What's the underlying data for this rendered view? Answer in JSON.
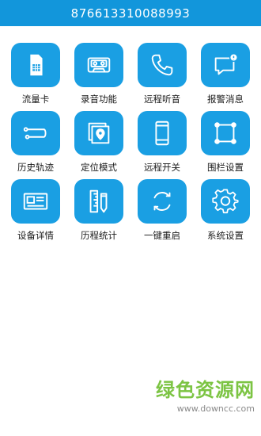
{
  "header": {
    "title": "876613310088993"
  },
  "colors": {
    "header_bg": "#1296db",
    "tile_bg": "#1a9fe3",
    "watermark_green": "#7cc443"
  },
  "menu": [
    {
      "label": "流量卡",
      "icon": "sim-card-icon"
    },
    {
      "label": "录音功能",
      "icon": "cassette-tape-icon"
    },
    {
      "label": "远程听音",
      "icon": "phone-icon"
    },
    {
      "label": "报警消息",
      "icon": "message-alert-icon"
    },
    {
      "label": "历史轨迹",
      "icon": "track-route-icon"
    },
    {
      "label": "定位模式",
      "icon": "location-photos-icon"
    },
    {
      "label": "远程开关",
      "icon": "smartphone-icon"
    },
    {
      "label": "围栏设置",
      "icon": "fence-square-icon"
    },
    {
      "label": "设备详情",
      "icon": "id-card-icon"
    },
    {
      "label": "历程统计",
      "icon": "ruler-pencil-icon"
    },
    {
      "label": "一键重启",
      "icon": "restart-icon"
    },
    {
      "label": "系统设置",
      "icon": "gear-icon"
    }
  ],
  "watermark": {
    "main": "绿色资源网",
    "url": "www.downcc.com"
  }
}
